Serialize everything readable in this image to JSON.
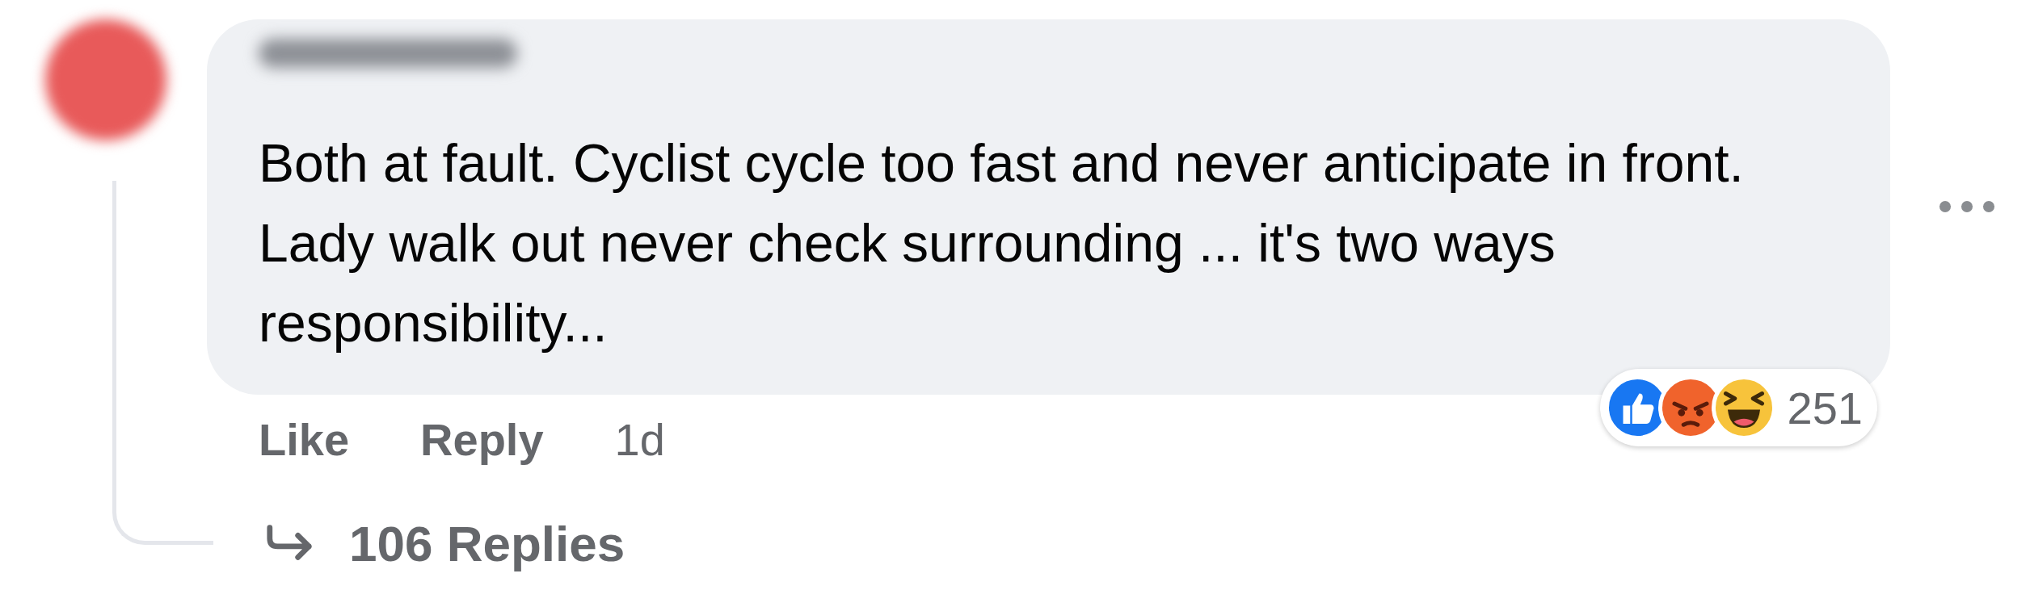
{
  "comment": {
    "text": "Both at fault. Cyclist cycle too fast and never anticipate in front. Lady walk out never check surrounding ... it's two ways responsibility...",
    "reactions": [
      {
        "kind": "like"
      },
      {
        "kind": "angry"
      },
      {
        "kind": "haha"
      }
    ],
    "reaction_count": "251",
    "actions": [
      "Like",
      "Reply"
    ],
    "time": "1d",
    "replies": "106 Replies"
  }
}
